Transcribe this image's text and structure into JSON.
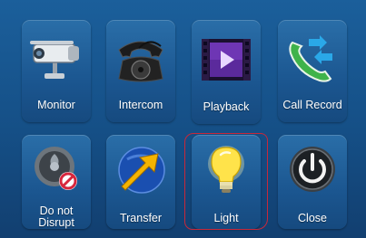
{
  "tiles": [
    {
      "label": "Monitor",
      "icon": "camera-icon"
    },
    {
      "label": "Intercom",
      "icon": "telephone-icon"
    },
    {
      "label": "Playback",
      "icon": "film-play-icon"
    },
    {
      "label": "Call Record",
      "icon": "call-record-icon"
    },
    {
      "label": "Do not\nDisrupt",
      "icon": "do-not-disturb-icon"
    },
    {
      "label": "Transfer",
      "icon": "transfer-arrow-icon"
    },
    {
      "label": "Light",
      "icon": "lightbulb-icon"
    },
    {
      "label": "Close",
      "icon": "power-icon"
    }
  ],
  "colors": {
    "background": "#1b5f9b",
    "tile": "#1b5690",
    "highlight": "#c8283a",
    "label": "#ffffff"
  }
}
